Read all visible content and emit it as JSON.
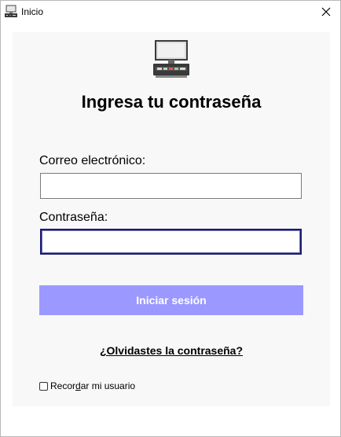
{
  "window": {
    "title": "Inicio",
    "close_icon": "close-icon"
  },
  "login": {
    "heading": "Ingresa tu contraseña",
    "email_label": "Correo electrónico:",
    "email_value": "",
    "password_label": "Contraseña:",
    "password_value": "",
    "submit_label": "Iniciar sesión",
    "forgot_label": "¿Olvidastes la contraseña?",
    "remember": {
      "pre": "Recor",
      "accel": "d",
      "post": "ar mi usuario",
      "checked": false
    }
  },
  "colors": {
    "panel_bg": "#f8f8f8",
    "button_bg": "#9b99ff",
    "button_text": "#ffffff",
    "focus_border": "#1c1c70"
  },
  "icons": {
    "app": "computer-terminal-icon"
  }
}
